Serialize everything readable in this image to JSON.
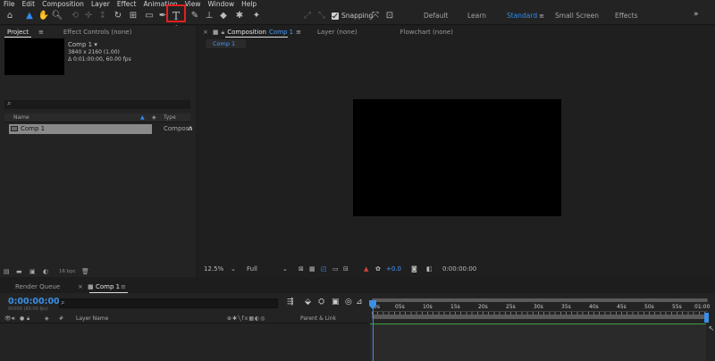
{
  "menu": [
    "File",
    "Edit",
    "Composition",
    "Layer",
    "Effect",
    "Animation",
    "View",
    "Window",
    "Help"
  ],
  "toolbar": {
    "snapping_label": "Snapping",
    "workspaces": [
      "Default",
      "Learn",
      "Standard",
      "Small Screen",
      "Effects"
    ],
    "active_workspace": "Standard",
    "overflow": "»",
    "text_tool_glyph": "T"
  },
  "project": {
    "tabs": [
      "Project",
      "Effect Controls (none)"
    ],
    "comp_name": "Comp 1 ▾",
    "comp_res": "3840 x 2160 (1.00)",
    "comp_dur": "Δ 0:01:00:00, 60.00 fps",
    "search_icon": "⌕",
    "col_name": "Name",
    "col_type": "Type",
    "items": [
      {
        "name": "Comp 1",
        "type": "Compos"
      }
    ],
    "bpc": "16 bpc"
  },
  "composition": {
    "close": "×",
    "tab_prefix": "Composition",
    "tab_name": "Comp 1",
    "tabs_other": [
      "Layer (none)",
      "Flowchart (none)"
    ],
    "subtab": "Comp 1",
    "zoom": "12.5%",
    "resolution": "Full",
    "exposure": "+0.0",
    "timecode": "0:00:00:00"
  },
  "timeline": {
    "tab_render": "Render Queue",
    "tab_comp": "Comp 1",
    "current_time": "0:00:00:00",
    "frame_info": "00000 (60.00 fps)",
    "col_layer_name": "Layer Name",
    "col_parent": "Parent & Link",
    "ruler_labels": [
      "0s",
      "05s",
      "10s",
      "15s",
      "20s",
      "25s",
      "30s",
      "35s",
      "40s",
      "45s",
      "50s",
      "55s",
      "01:00"
    ]
  },
  "colors": {
    "accent": "#2f8cf2",
    "highlight_frame": "#e02020"
  }
}
